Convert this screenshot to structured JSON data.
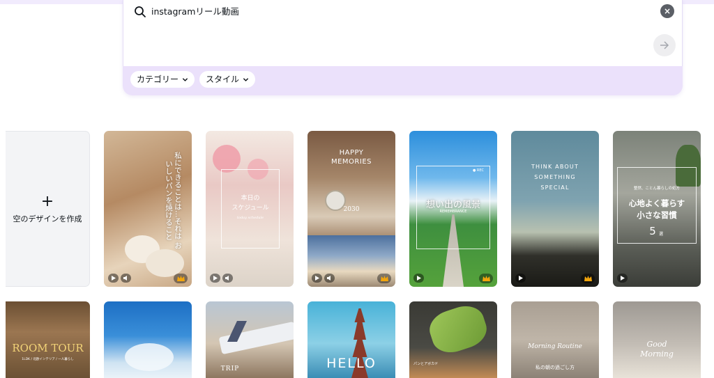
{
  "search": {
    "query": "instagramリール動画",
    "clear_symbol": "×",
    "submit_symbol": "→"
  },
  "filters": {
    "category_label": "カテゴリー",
    "style_label": "スタイル"
  },
  "blank_card": {
    "plus": "+",
    "label": "空のデザインを作成"
  },
  "templates_row1": [
    {
      "id": "t1",
      "text": "私にできることは…それは\nおいしいパンを焼けること"
    },
    {
      "id": "t2",
      "title": "本日の\nスケジュール",
      "sub": "today schedule"
    },
    {
      "id": "t3",
      "title": "HAPPY\nMEMORIES",
      "sub": "2030"
    },
    {
      "id": "t4",
      "title": "想い出の風景",
      "sub": "REMEMBRANCE",
      "badge": "● REC"
    },
    {
      "id": "t5",
      "title": "THINK ABOUT\nSOMETHING\nSPECIAL"
    },
    {
      "id": "t6",
      "small": "整然、ことん暮らしの処方",
      "title": "心地よく暮らす\n小さな習慣",
      "num": "5",
      "unit": "選"
    }
  ],
  "templates_row2": [
    {
      "id": "t7",
      "title": "ROOM TOUR",
      "sub": "1LDK / 北欧インテリア / 一人暮らし"
    },
    {
      "id": "t8"
    },
    {
      "id": "t9",
      "title": "TRIP"
    },
    {
      "id": "t10",
      "title": "HELLO"
    },
    {
      "id": "t11",
      "title": "パンとアボカド"
    },
    {
      "id": "t12",
      "title": "Morning Routine",
      "sub": "私の朝の過ごし方"
    },
    {
      "id": "t13",
      "title": "Good\nMorning"
    }
  ],
  "icons": {
    "play": "play-icon",
    "volume": "volume-icon",
    "crown": "crown-icon"
  },
  "colors": {
    "panel": "#ebe1fb",
    "crown": "#f2a50c",
    "clear_button": "#5b5f66"
  }
}
